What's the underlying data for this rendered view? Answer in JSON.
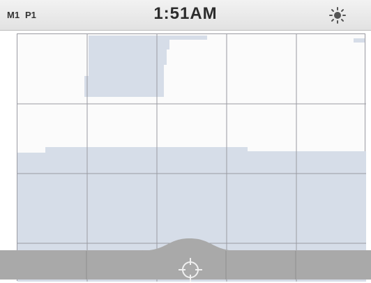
{
  "header": {
    "mode_label": "M1",
    "profile_label": "P1",
    "clock": "1:51AM",
    "brightness_icon": "sun-icon"
  },
  "bottom_bar": {
    "target_icon": "crosshair-icon"
  },
  "colors": {
    "signal_fill": "#d6dde8",
    "grid_line": "#9a9aa2",
    "bottom_bar": "#a9a9a9",
    "header_bg": "#e6e6e6"
  }
}
